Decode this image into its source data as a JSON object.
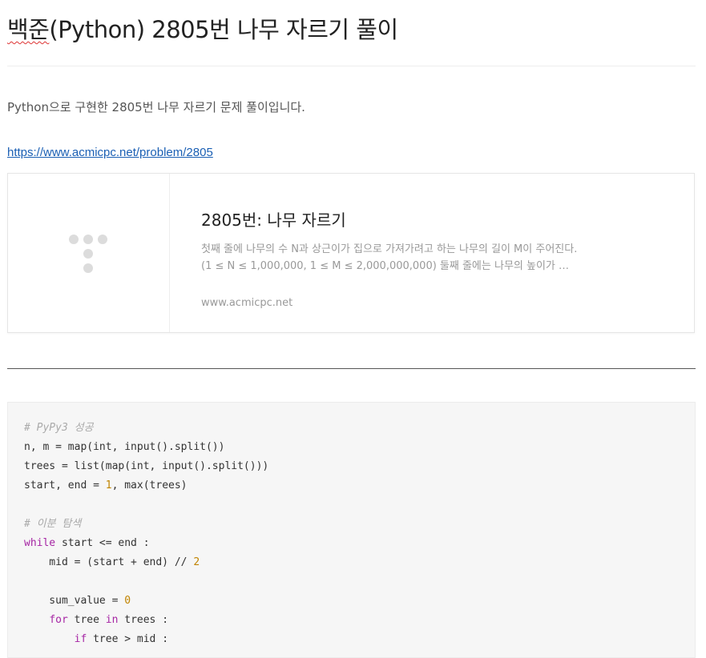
{
  "post": {
    "title_prefix": "백준",
    "title_rest": "(Python) 2805번 나무 자르기 풀이",
    "intro": "Python으로 구현한 2805번 나무 자르기 문제 풀이입니다.",
    "link": "https://www.acmicpc.net/problem/2805"
  },
  "card": {
    "title": "2805번: 나무 자르기",
    "description": "첫째 줄에 나무의 수 N과 상근이가 집으로 가져가려고 하는 나무의 길이 M이 주어진다. (1 ≤ N ≤ 1,000,000, 1 ≤ M ≤ 2,000,000,000) 둘째 줄에는 나무의 높이가 주어진다.",
    "domain": "www.acmicpc.net"
  },
  "code": {
    "lines": [
      [
        {
          "t": "# PyPy3 성공",
          "c": "cmt"
        }
      ],
      [
        {
          "t": "n, m = map(int, input().split())",
          "c": ""
        }
      ],
      [
        {
          "t": "trees = list(map(int, input().split()))",
          "c": ""
        }
      ],
      [
        {
          "t": "start, end = ",
          "c": ""
        },
        {
          "t": "1",
          "c": "num"
        },
        {
          "t": ", max(trees)",
          "c": ""
        }
      ],
      [],
      [
        {
          "t": "# 이분 탐색",
          "c": "cmt"
        }
      ],
      [
        {
          "t": "while",
          "c": "kw"
        },
        {
          "t": " start <= end :",
          "c": ""
        }
      ],
      [
        {
          "t": "    mid = (start + end) // ",
          "c": ""
        },
        {
          "t": "2",
          "c": "num"
        }
      ],
      [],
      [
        {
          "t": "    sum_value = ",
          "c": ""
        },
        {
          "t": "0",
          "c": "num"
        }
      ],
      [
        {
          "t": "    ",
          "c": ""
        },
        {
          "t": "for",
          "c": "kw"
        },
        {
          "t": " tree ",
          "c": ""
        },
        {
          "t": "in",
          "c": "kw"
        },
        {
          "t": " trees :",
          "c": ""
        }
      ],
      [
        {
          "t": "        ",
          "c": ""
        },
        {
          "t": "if",
          "c": "kw"
        },
        {
          "t": " tree > mid :",
          "c": ""
        }
      ]
    ]
  }
}
